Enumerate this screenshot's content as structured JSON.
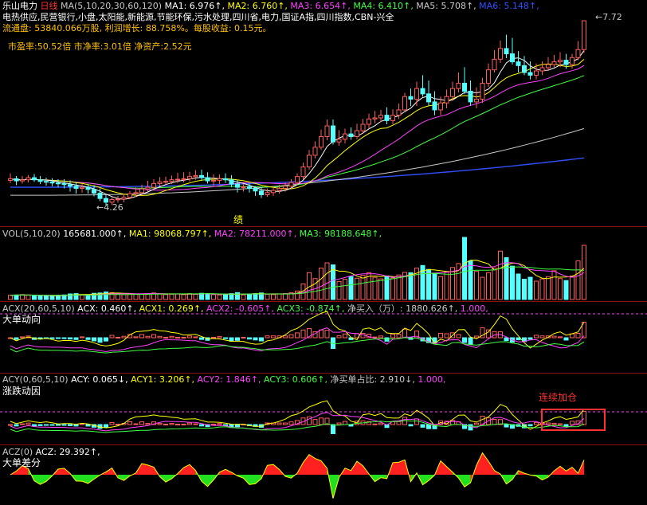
{
  "header": {
    "stock_name": "乐山电力",
    "period": "日线",
    "ma_label": "MA(5,10,20,30,60,120)",
    "ma_values": [
      {
        "name": "MA1",
        "value": "6.976",
        "arrow": "↑",
        "color": "#ffffff"
      },
      {
        "name": "MA2",
        "value": "6.760",
        "arrow": "↑",
        "color": "#ffff00"
      },
      {
        "name": "MA3",
        "value": "6.654",
        "arrow": "↑",
        "color": "#ff40ff"
      },
      {
        "name": "MA4",
        "value": "6.410",
        "arrow": "↑",
        "color": "#40ff40"
      },
      {
        "name": "MA5",
        "value": "5.708",
        "arrow": "↑",
        "color": "#c8c8c8"
      },
      {
        "name": "MA6",
        "value": "5.148",
        "arrow": "↑",
        "color": "#3050ff"
      }
    ],
    "concepts": "电热供应,民营银行,小盘,太阳能,新能源,节能环保,污水处理,四川省,电力,国证A指,四川指数,CBN-兴全",
    "float_info": "流通盘: 53840.066万股, 利润增长: 88.758%。每股收益: 0.15元。",
    "valuation": "市盈率:50.52倍  市净率:3.01倍  净资产:2.52元"
  },
  "annotations": {
    "high_price": "7.72",
    "low_price": "4.26",
    "marker": "绩",
    "acy_callout": "连续加仓"
  },
  "panels": {
    "vol": {
      "label": "VOL(5,10,20)",
      "items": [
        {
          "name": "",
          "value": "165681.000",
          "arrow": "↑",
          "color": "#ffffff"
        },
        {
          "name": "MA1",
          "value": "98068.797",
          "arrow": "↑",
          "color": "#ffff00"
        },
        {
          "name": "MA2",
          "value": "78211.000",
          "arrow": "↑",
          "color": "#ff40ff"
        },
        {
          "name": "MA3",
          "value": "98188.648",
          "arrow": "↑",
          "color": "#40ff40"
        }
      ]
    },
    "acx": {
      "label": "ACX(20,60,5,10)",
      "title": "大单动向",
      "items": [
        {
          "name": "ACX",
          "value": "0.460",
          "arrow": "↑",
          "color": "#ffffff"
        },
        {
          "name": "ACX1",
          "value": "0.269",
          "arrow": "↑",
          "color": "#ffff00"
        },
        {
          "name": "ACX2",
          "value": "-0.605",
          "arrow": "↑",
          "color": "#ff40ff"
        },
        {
          "name": "ACX3",
          "value": "-0.874",
          "arrow": "↑",
          "color": "#40ff40"
        },
        {
          "name": "净买入（万）",
          "value": "1880.626",
          "arrow": "↑",
          "color": "#c8c8c8"
        },
        {
          "name": "",
          "value": "1.000",
          "arrow": "",
          "color": "#ff40ff"
        }
      ]
    },
    "acy": {
      "label": "ACY(0,60,5,10)",
      "title": "涨跌动因",
      "items": [
        {
          "name": "ACY",
          "value": "0.065",
          "arrow": "↓",
          "color": "#ffffff"
        },
        {
          "name": "ACY1",
          "value": "3.206",
          "arrow": "↑",
          "color": "#ffff00"
        },
        {
          "name": "ACY2",
          "value": "1.846",
          "arrow": "↑",
          "color": "#ff40ff"
        },
        {
          "name": "ACY3",
          "value": "0.606",
          "arrow": "↑",
          "color": "#40ff40"
        },
        {
          "name": "净买单占比",
          "value": "2.910",
          "arrow": "↓",
          "color": "#c8c8c8"
        },
        {
          "name": "",
          "value": "1.000",
          "arrow": "",
          "color": "#ff40ff"
        }
      ]
    },
    "acz": {
      "label": "ACZ(0)",
      "title": "大单差分",
      "items": [
        {
          "name": "ACZ",
          "value": "29.392",
          "arrow": "↑",
          "color": "#ffffff"
        }
      ]
    }
  },
  "colors": {
    "up": "#ff5c5c",
    "up_fill": "#000000",
    "down": "#54ffff",
    "label": "#c8c8c8",
    "title_red": "#ff3030",
    "concept": "#ffffff",
    "valuation": "#ffc000",
    "separator": "#8a1010"
  },
  "chart_data": [
    {
      "type": "candlestick",
      "title": "乐山电力 日线",
      "price_range": [
        3.9,
        7.9
      ],
      "series": [
        {
          "name": "open",
          "values": [
            4.73,
            4.76,
            4.72,
            4.74,
            4.78,
            4.74,
            4.71,
            4.7,
            4.68,
            4.67,
            4.65,
            4.62,
            4.58,
            4.6,
            4.56,
            4.49,
            4.39,
            4.32,
            4.37,
            4.38,
            4.41,
            4.48,
            4.5,
            4.57,
            4.6,
            4.67,
            4.7,
            4.71,
            4.74,
            4.75,
            4.76,
            4.8,
            4.82,
            4.78,
            4.72,
            4.73,
            4.76,
            4.74,
            4.66,
            4.6,
            4.61,
            4.58,
            4.53,
            4.46,
            4.5,
            4.54,
            4.58,
            4.62,
            4.69,
            4.8,
            4.98,
            5.2,
            5.35,
            5.55,
            5.75,
            5.45,
            5.5,
            5.6,
            5.55,
            5.66,
            5.78,
            5.88,
            5.9,
            5.95,
            5.85,
            5.95,
            6.05,
            6.3,
            6.25,
            6.45,
            6.35,
            6.2,
            6.05,
            6.18,
            6.3,
            6.45,
            6.55,
            6.4,
            6.2,
            6.25,
            6.55,
            6.8,
            7.0,
            7.2,
            7.1,
            6.95,
            6.88,
            6.75,
            6.7,
            6.78,
            6.84,
            6.9,
            6.95,
            6.98,
            6.9,
            7.03,
            7.18
          ]
        },
        {
          "name": "high",
          "values": [
            4.86,
            4.81,
            4.81,
            4.83,
            4.85,
            4.81,
            4.78,
            4.77,
            4.75,
            4.75,
            4.73,
            4.7,
            4.67,
            4.66,
            4.64,
            4.58,
            4.45,
            4.41,
            4.44,
            4.48,
            4.53,
            4.6,
            4.65,
            4.72,
            4.75,
            4.79,
            4.8,
            4.82,
            4.87,
            4.88,
            4.89,
            4.92,
            4.93,
            4.88,
            4.84,
            4.84,
            4.86,
            4.83,
            4.73,
            4.67,
            4.67,
            4.62,
            4.6,
            4.58,
            4.61,
            4.65,
            4.69,
            4.75,
            4.86,
            5.06,
            5.3,
            5.46,
            5.68,
            5.87,
            5.87,
            5.67,
            5.7,
            5.72,
            5.79,
            5.88,
            5.98,
            6.03,
            6.05,
            6.1,
            6.06,
            6.17,
            6.37,
            6.45,
            6.58,
            6.7,
            6.6,
            6.4,
            6.3,
            6.43,
            6.58,
            6.75,
            6.85,
            6.6,
            6.47,
            6.65,
            6.92,
            7.17,
            7.35,
            7.46,
            7.4,
            7.15,
            7.06,
            6.96,
            6.92,
            6.96,
            7.04,
            7.08,
            7.13,
            7.1,
            7.1,
            7.34,
            7.72
          ]
        },
        {
          "name": "low",
          "values": [
            4.68,
            4.64,
            4.67,
            4.69,
            4.7,
            4.66,
            4.63,
            4.62,
            4.6,
            4.58,
            4.52,
            4.48,
            4.5,
            4.48,
            4.43,
            4.34,
            4.26,
            4.27,
            4.31,
            4.32,
            4.38,
            4.42,
            4.45,
            4.52,
            4.56,
            4.62,
            4.65,
            4.66,
            4.68,
            4.69,
            4.71,
            4.74,
            4.72,
            4.67,
            4.63,
            4.66,
            4.68,
            4.6,
            4.5,
            4.52,
            4.5,
            4.44,
            4.4,
            4.42,
            4.44,
            4.48,
            4.52,
            4.58,
            4.64,
            4.74,
            4.93,
            5.14,
            5.3,
            5.48,
            5.4,
            5.38,
            5.42,
            5.49,
            5.5,
            5.6,
            5.7,
            5.8,
            5.82,
            5.78,
            5.78,
            5.88,
            6.0,
            6.12,
            6.12,
            6.3,
            6.12,
            5.95,
            5.95,
            6.08,
            6.22,
            6.38,
            6.35,
            6.13,
            6.08,
            6.18,
            6.48,
            6.75,
            6.93,
            7.02,
            6.9,
            6.75,
            6.7,
            6.62,
            6.62,
            6.7,
            6.78,
            6.85,
            6.85,
            6.82,
            6.82,
            6.98,
            7.12
          ]
        },
        {
          "name": "close",
          "values": [
            4.76,
            4.72,
            4.74,
            4.78,
            4.74,
            4.71,
            4.7,
            4.68,
            4.67,
            4.65,
            4.62,
            4.58,
            4.6,
            4.56,
            4.49,
            4.39,
            4.32,
            4.37,
            4.38,
            4.41,
            4.48,
            4.5,
            4.57,
            4.6,
            4.67,
            4.7,
            4.71,
            4.74,
            4.75,
            4.76,
            4.8,
            4.82,
            4.78,
            4.72,
            4.73,
            4.76,
            4.74,
            4.66,
            4.6,
            4.61,
            4.58,
            4.53,
            4.46,
            4.5,
            4.54,
            4.58,
            4.62,
            4.69,
            4.8,
            4.98,
            5.2,
            5.35,
            5.55,
            5.75,
            5.45,
            5.5,
            5.6,
            5.55,
            5.66,
            5.78,
            5.88,
            5.9,
            5.95,
            5.85,
            5.95,
            6.05,
            6.3,
            6.25,
            6.45,
            6.35,
            6.2,
            6.05,
            6.18,
            6.3,
            6.45,
            6.55,
            6.4,
            6.2,
            6.25,
            6.55,
            6.8,
            7.0,
            7.2,
            7.1,
            6.95,
            6.88,
            6.75,
            6.7,
            6.78,
            6.84,
            6.9,
            6.95,
            6.98,
            6.9,
            7.03,
            7.18,
            7.72
          ]
        }
      ]
    },
    {
      "type": "bar",
      "title": "VOL(5,10,20)",
      "volume_max": 190000,
      "series": [
        {
          "name": "volume",
          "values": [
            13000,
            14000,
            15000,
            13000,
            12000,
            11000,
            11000,
            12000,
            13000,
            14000,
            17000,
            18000,
            13000,
            15000,
            19000,
            20000,
            23000,
            21000,
            16000,
            15000,
            17000,
            16000,
            17000,
            18000,
            20000,
            17000,
            15000,
            16000,
            17000,
            15000,
            18000,
            16000,
            19000,
            18000,
            15000,
            14000,
            15000,
            18000,
            21000,
            14000,
            17000,
            18000,
            20000,
            16000,
            15000,
            17000,
            18000,
            21000,
            26000,
            48000,
            82000,
            64000,
            96000,
            112000,
            106000,
            55000,
            62000,
            70000,
            65000,
            74000,
            82000,
            68000,
            63000,
            72000,
            66000,
            75000,
            83000,
            82000,
            96000,
            104000,
            92000,
            78000,
            70000,
            85000,
            98000,
            110000,
            190000,
            118000,
            86000,
            68000,
            82000,
            96000,
            148000,
            128000,
            102000,
            78000,
            62000,
            68000,
            56000,
            63000,
            70000,
            88000,
            64000,
            58000,
            72000,
            118000,
            165681
          ]
        }
      ]
    }
  ]
}
